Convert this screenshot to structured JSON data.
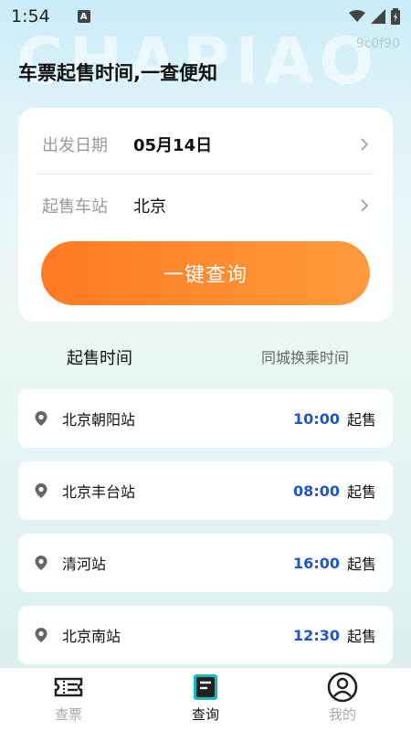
{
  "status": {
    "time": "1:54",
    "a_badge": "A"
  },
  "watermark": "CHAPIAO",
  "corner_code": "9c0f90",
  "title": "车票起售时间,一查便知",
  "query": {
    "date_label": "出发日期",
    "date_value": "05月14日",
    "station_label": "起售车站",
    "station_value": "北京",
    "button_label": "一键查询"
  },
  "tabs": [
    {
      "label": "起售时间"
    },
    {
      "label": "同城换乘时间"
    }
  ],
  "stations": [
    {
      "name": "北京朝阳站",
      "time": "10:00",
      "suffix": "起售"
    },
    {
      "name": "北京丰台站",
      "time": "08:00",
      "suffix": "起售"
    },
    {
      "name": "清河站",
      "time": "16:00",
      "suffix": "起售"
    },
    {
      "name": "北京南站",
      "time": "12:30",
      "suffix": "起售"
    }
  ],
  "nav": [
    {
      "label": "查票",
      "icon": "ticket-icon"
    },
    {
      "label": "查询",
      "icon": "query-icon"
    },
    {
      "label": "我的",
      "icon": "profile-icon"
    }
  ],
  "colors": {
    "accent": "#ff7a22",
    "time_blue": "#1f56c6"
  }
}
